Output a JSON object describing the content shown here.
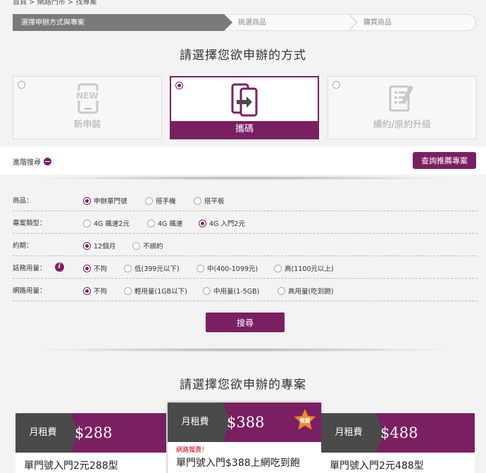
{
  "breadcrumb": "首頁 > 網路門市 > 找專案",
  "steps": [
    "選擇申辦方式與專案",
    "挑選商品",
    "購買商品"
  ],
  "method_title": "請選擇您欲申辦的方式",
  "methods": [
    {
      "label": "新申裝",
      "icon_text": "NEW"
    },
    {
      "label": "攜碼"
    },
    {
      "label": "續約/原約升級"
    }
  ],
  "advanced_label": "進階搜尋",
  "recommend_button": "查詢推薦專案",
  "filters": [
    {
      "label": "商品：",
      "options": [
        "申辦單門號",
        "搭手機",
        "搭平板"
      ],
      "selected": 0
    },
    {
      "label": "專案類型：",
      "options": [
        "4G 飆速2元",
        "4G 飆速",
        "4G 入門2元"
      ],
      "selected": 2
    },
    {
      "label": "約期：",
      "options": [
        "12個月",
        "不綁約"
      ],
      "selected": 0
    },
    {
      "label": "話務用量：",
      "options": [
        "不拘",
        "低(399元以下)",
        "中(400-1099元)",
        "高(1100元以上)"
      ],
      "selected": 0
    },
    {
      "label": "網路用量：",
      "options": [
        "不拘",
        "輕用量(1GB以下)",
        "中用量(1-5GB)",
        "高用量(吃到飽)"
      ],
      "selected": 0
    }
  ],
  "search_button": "搜尋",
  "plan_title": "請選擇您欲申辦的專案",
  "plans": [
    {
      "rent_label": "月租費",
      "price": "$288",
      "name": "單門號入門2元288型"
    },
    {
      "rent_label": "月租費",
      "price": "$388",
      "tag": "網路獨賣！",
      "name": "單門號入門$388上網吃到飽",
      "badge": "推薦"
    },
    {
      "rent_label": "月租費",
      "price": "$488",
      "name": "單門號入門2元488型"
    }
  ],
  "colors": {
    "accent": "#7b1f63",
    "dark": "#4a4a4a",
    "badge": "#f0882a"
  }
}
